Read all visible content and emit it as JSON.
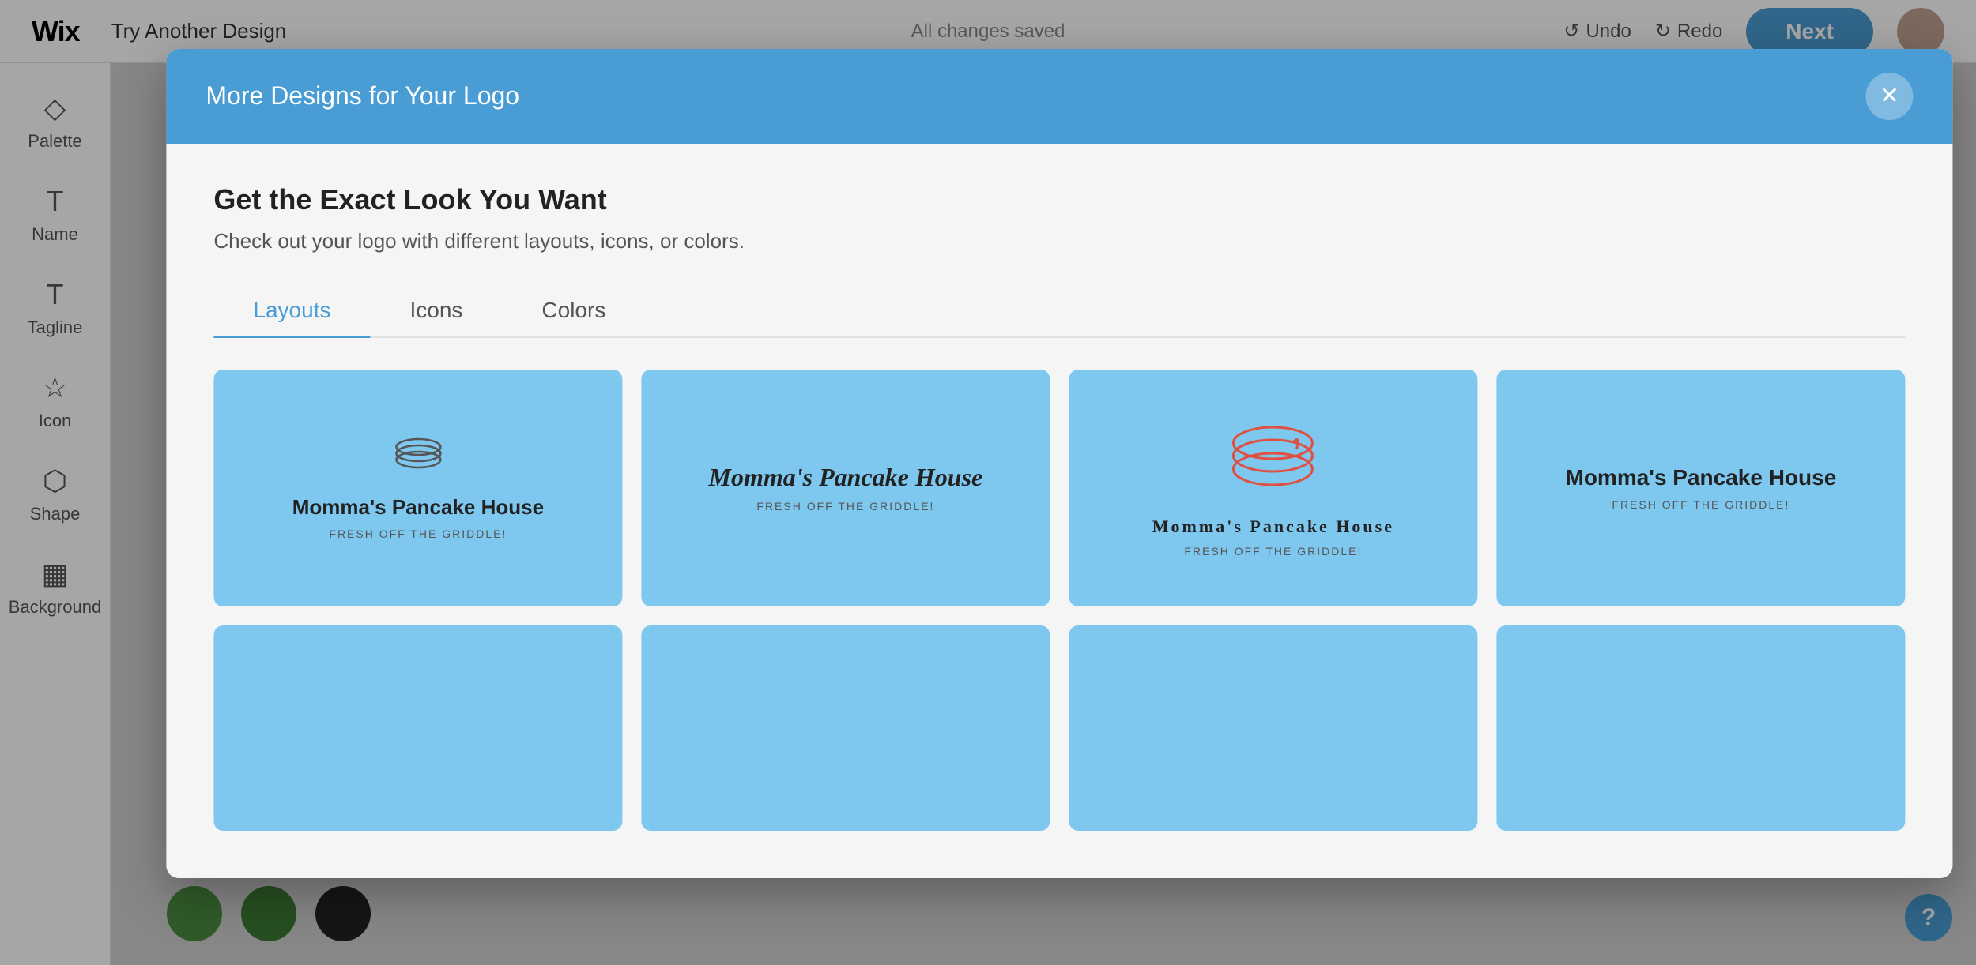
{
  "topbar": {
    "logo": "Wix",
    "try_another": "Try Another Design",
    "save_status": "All changes saved",
    "undo_label": "Undo",
    "redo_label": "Redo",
    "next_label": "Next"
  },
  "sidebar": {
    "items": [
      {
        "id": "palette",
        "label": "Palette",
        "icon": "palette"
      },
      {
        "id": "name",
        "label": "Name",
        "icon": "text"
      },
      {
        "id": "tagline",
        "label": "Tagline",
        "icon": "tagline"
      },
      {
        "id": "icon",
        "label": "Icon",
        "icon": "star"
      },
      {
        "id": "shape",
        "label": "Shape",
        "icon": "diamond"
      },
      {
        "id": "background",
        "label": "Background",
        "icon": "background"
      }
    ]
  },
  "modal": {
    "header_title": "More Designs for Your Logo",
    "section_title": "Get the Exact Look You Want",
    "section_subtitle": "Check out your logo with different layouts, icons, or colors.",
    "tabs": [
      {
        "id": "layouts",
        "label": "Layouts",
        "active": true
      },
      {
        "id": "icons",
        "label": "Icons",
        "active": false
      },
      {
        "id": "colors",
        "label": "Colors",
        "active": false
      }
    ],
    "logo_cards": [
      {
        "id": "card1",
        "brand_name": "Momma's Pancake House",
        "tagline": "FRESH OFF THE GRIDDLE!",
        "style": "icon-top"
      },
      {
        "id": "card2",
        "brand_name": "Momma's Pancake House",
        "tagline": "FRESH OFF THE GRIDDLE!",
        "style": "italic-centered"
      },
      {
        "id": "card3",
        "brand_name": "Momma's Pancake House",
        "tagline": "FRESH OFF THE GRIDDLE!",
        "style": "large-icon"
      },
      {
        "id": "card4",
        "brand_name": "Momma's Pancake House",
        "tagline": "FRESH OFF THE GRIDDLE!",
        "style": "text-only-right"
      },
      {
        "id": "card5",
        "brand_name": "",
        "tagline": "",
        "style": "empty"
      },
      {
        "id": "card6",
        "brand_name": "",
        "tagline": "",
        "style": "empty"
      },
      {
        "id": "card7",
        "brand_name": "",
        "tagline": "",
        "style": "empty"
      },
      {
        "id": "card8",
        "brand_name": "",
        "tagline": "",
        "style": "empty"
      }
    ]
  },
  "color_circles": [
    {
      "color": "#4a8c3f"
    },
    {
      "color": "#3d7a35"
    },
    {
      "color": "#222222"
    }
  ],
  "help": "?"
}
